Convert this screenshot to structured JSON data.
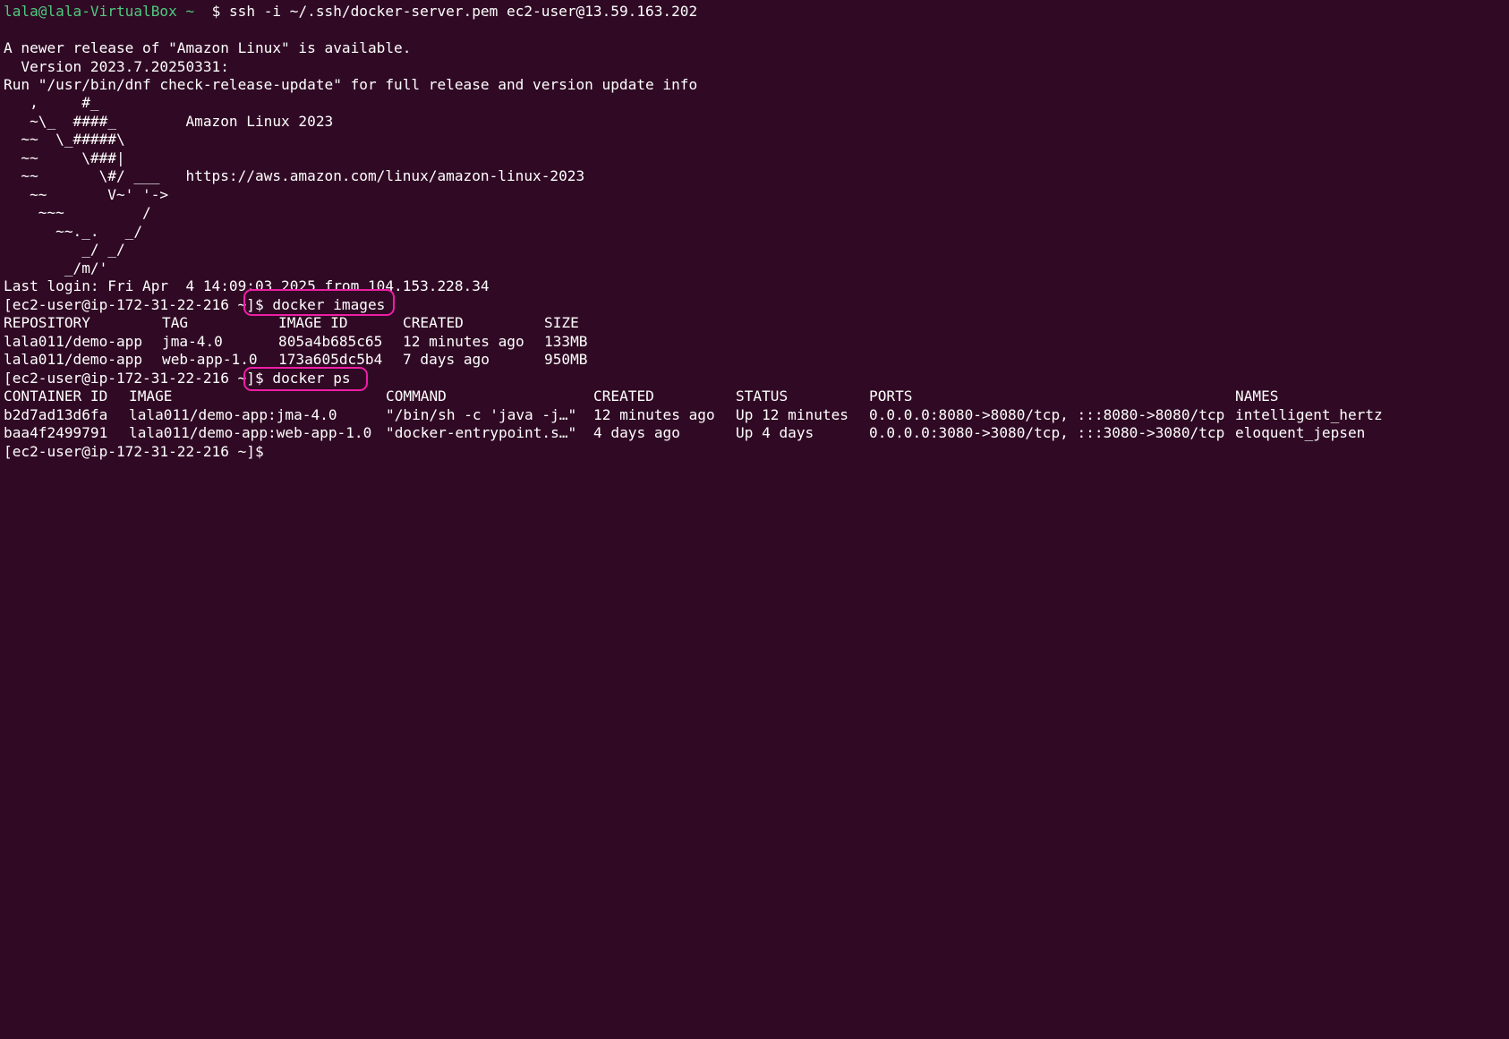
{
  "terminal": {
    "ssh_prompt_user": "lala@lala-VirtualBox",
    "ssh_prompt_dir": " ~",
    "ssh_command": "  $ ssh -i ~/.ssh/docker-server.pem ec2-user@13.59.163.202",
    "motd": [
      "A newer release of \"Amazon Linux\" is available.",
      "  Version 2023.7.20250331:",
      "Run \"/usr/bin/dnf check-release-update\" for full release and version update info"
    ],
    "ascii_art": [
      "   ,     #_",
      "   ~\\_  ####_        Amazon Linux 2023",
      "  ~~  \\_#####\\",
      "  ~~     \\###|",
      "  ~~       \\#/ ___   https://aws.amazon.com/linux/amazon-linux-2023",
      "   ~~       V~' '->",
      "    ~~~         /",
      "      ~~._.   _/",
      "         _/ _/",
      "       _/m/'"
    ],
    "last_login": "Last login: Fri Apr  4 14:09:03 2025 from 104.153.228.34",
    "remote_prompt": "[ec2-user@ip-172-31-22-216 ~]$",
    "command_images": " docker images",
    "images_table": {
      "headers": [
        "REPOSITORY",
        "TAG",
        "IMAGE ID",
        "CREATED",
        "SIZE"
      ],
      "rows": [
        [
          "lala011/demo-app",
          "jma-4.0",
          "805a4b685c65",
          "12 minutes ago",
          "133MB"
        ],
        [
          "lala011/demo-app",
          "web-app-1.0",
          "173a605dc5b4",
          "7 days ago",
          "950MB"
        ]
      ]
    },
    "command_ps": " docker ps",
    "ps_table": {
      "headers": [
        "CONTAINER ID",
        "IMAGE",
        "COMMAND",
        "CREATED",
        "STATUS",
        "PORTS",
        "NAMES"
      ],
      "rows": [
        [
          "b2d7ad13d6fa",
          "lala011/demo-app:jma-4.0",
          "\"/bin/sh -c 'java -j…\"",
          "12 minutes ago",
          "Up 12 minutes",
          "0.0.0.0:8080->8080/tcp, :::8080->8080/tcp",
          "intelligent_hertz"
        ],
        [
          "baa4f2499791",
          "lala011/demo-app:web-app-1.0",
          "\"docker-entrypoint.s…\"",
          "4 days ago",
          "Up 4 days",
          "0.0.0.0:3080->3080/tcp, :::3080->3080/tcp",
          "eloquent_jepsen"
        ]
      ]
    },
    "colors": {
      "background": "#300a24",
      "text": "#ffffff",
      "prompt_green": "#4ec97e",
      "highlight_pink": "#ec1fa4"
    }
  }
}
